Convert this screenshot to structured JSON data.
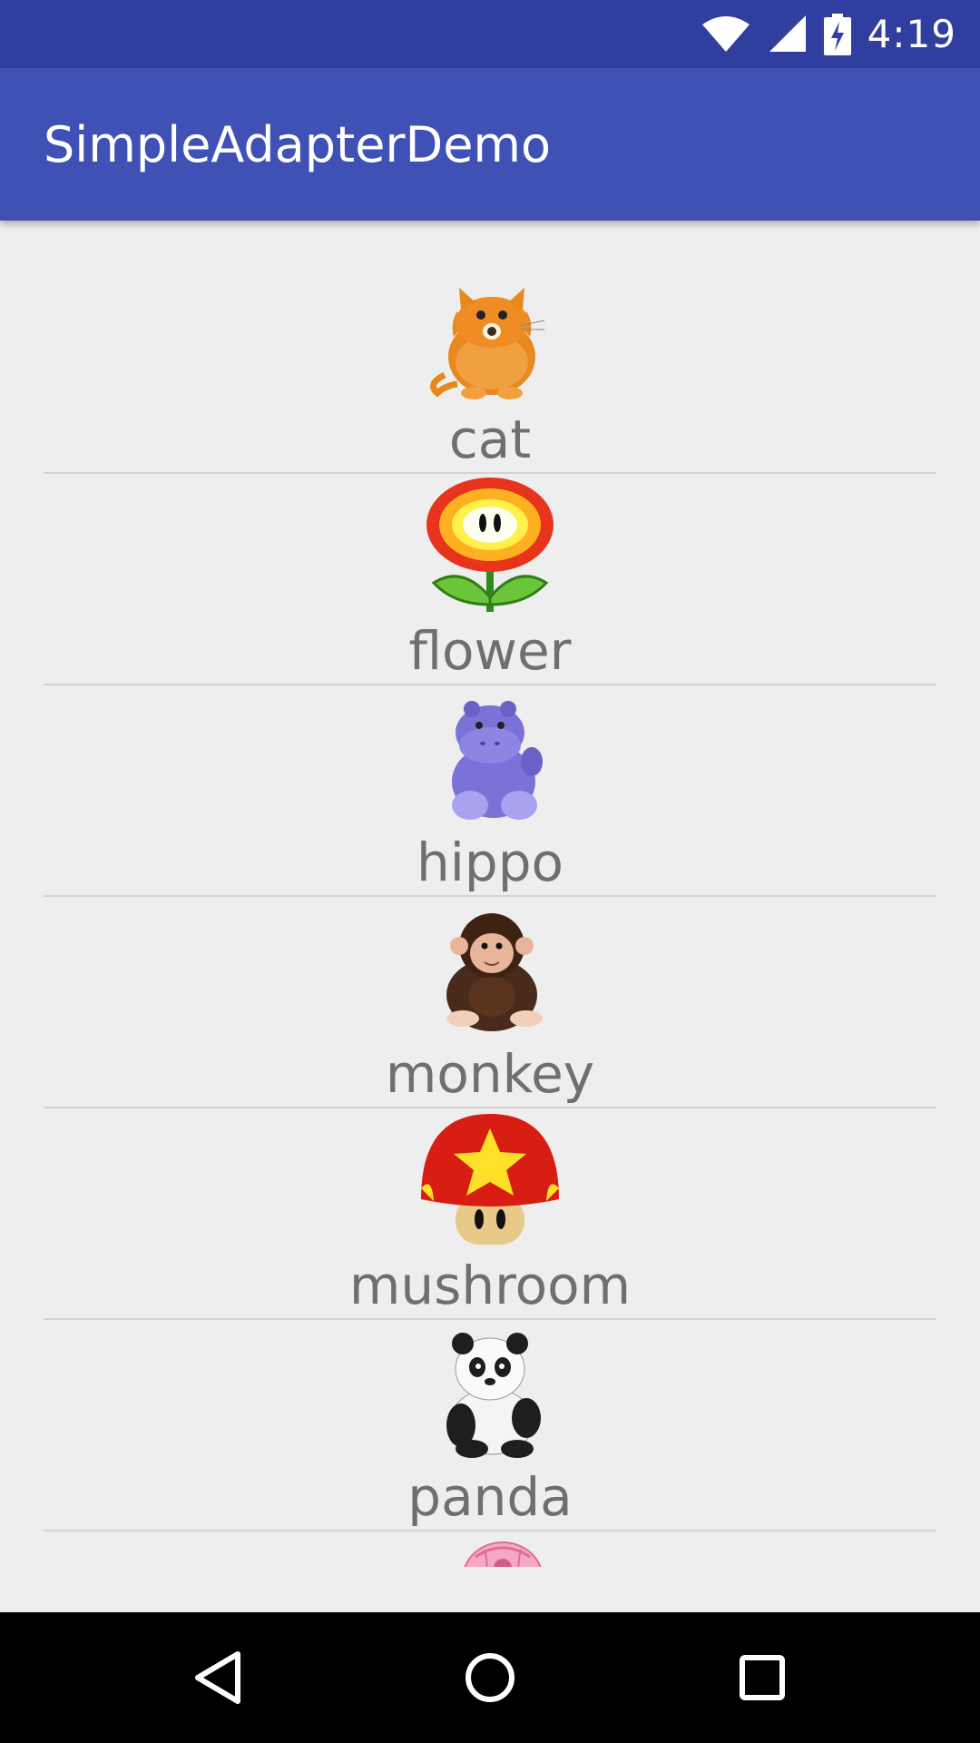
{
  "status_bar": {
    "time": "4:19",
    "icons": [
      "wifi-icon",
      "cell-signal-icon",
      "battery-charging-icon"
    ]
  },
  "app_bar": {
    "title": "SimpleAdapterDemo"
  },
  "list": {
    "items": [
      {
        "label": "cat",
        "icon": "cat-icon"
      },
      {
        "label": "flower",
        "icon": "flower-icon"
      },
      {
        "label": "hippo",
        "icon": "hippo-icon"
      },
      {
        "label": "monkey",
        "icon": "monkey-icon"
      },
      {
        "label": "mushroom",
        "icon": "mushroom-icon"
      },
      {
        "label": "panda",
        "icon": "panda-icon"
      },
      {
        "label": "",
        "icon": "partially-visible-item-icon"
      }
    ]
  },
  "nav_bar": {
    "buttons": [
      "back-icon",
      "home-icon",
      "recents-icon"
    ]
  }
}
